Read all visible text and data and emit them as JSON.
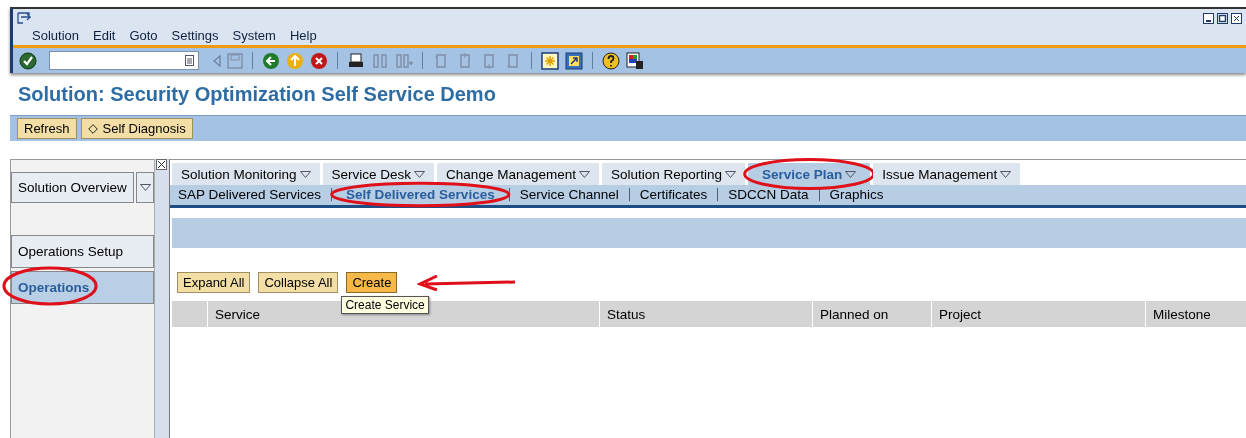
{
  "menu": [
    "Solution",
    "Edit",
    "Goto",
    "Settings",
    "System",
    "Help"
  ],
  "page_title": "Solution: Security Optimization Self Service Demo",
  "action_buttons": [
    {
      "label": "Refresh",
      "kind": "plain"
    },
    {
      "label": "Self Diagnosis",
      "kind": "diamond"
    }
  ],
  "sidebar": {
    "dropdown": "Solution Overview",
    "items": [
      {
        "label": "Operations Setup",
        "selected": false,
        "circled": false
      },
      {
        "label": "Operations",
        "selected": true,
        "circled": true
      }
    ]
  },
  "tabs": [
    {
      "label": "Solution Monitoring",
      "selected": false,
      "circled": false
    },
    {
      "label": "Service Desk",
      "selected": false,
      "circled": false
    },
    {
      "label": "Change Management",
      "selected": false,
      "circled": false
    },
    {
      "label": "Solution Reporting",
      "selected": false,
      "circled": false
    },
    {
      "label": "Service Plan",
      "selected": true,
      "circled": true
    },
    {
      "label": "Issue Management",
      "selected": false,
      "circled": false
    }
  ],
  "subtabs": [
    {
      "label": "SAP Delivered Services",
      "selected": false,
      "circled": false
    },
    {
      "label": "Self Delivered Services",
      "selected": true,
      "circled": true
    },
    {
      "label": "Service Channel",
      "selected": false,
      "circled": false
    },
    {
      "label": "Certificates",
      "selected": false,
      "circled": false
    },
    {
      "label": "SDCCN Data",
      "selected": false,
      "circled": false
    },
    {
      "label": "Graphics",
      "selected": false,
      "circled": false
    }
  ],
  "table_buttons": [
    {
      "label": "Expand All",
      "highlighted": false,
      "arrow": false
    },
    {
      "label": "Collapse All",
      "highlighted": false,
      "arrow": false
    },
    {
      "label": "Create",
      "highlighted": true,
      "arrow": true,
      "tooltip": "Create Service"
    }
  ],
  "table": {
    "columns": [
      "Service",
      "Status",
      "Planned on",
      "Project",
      "Milestone"
    ]
  }
}
